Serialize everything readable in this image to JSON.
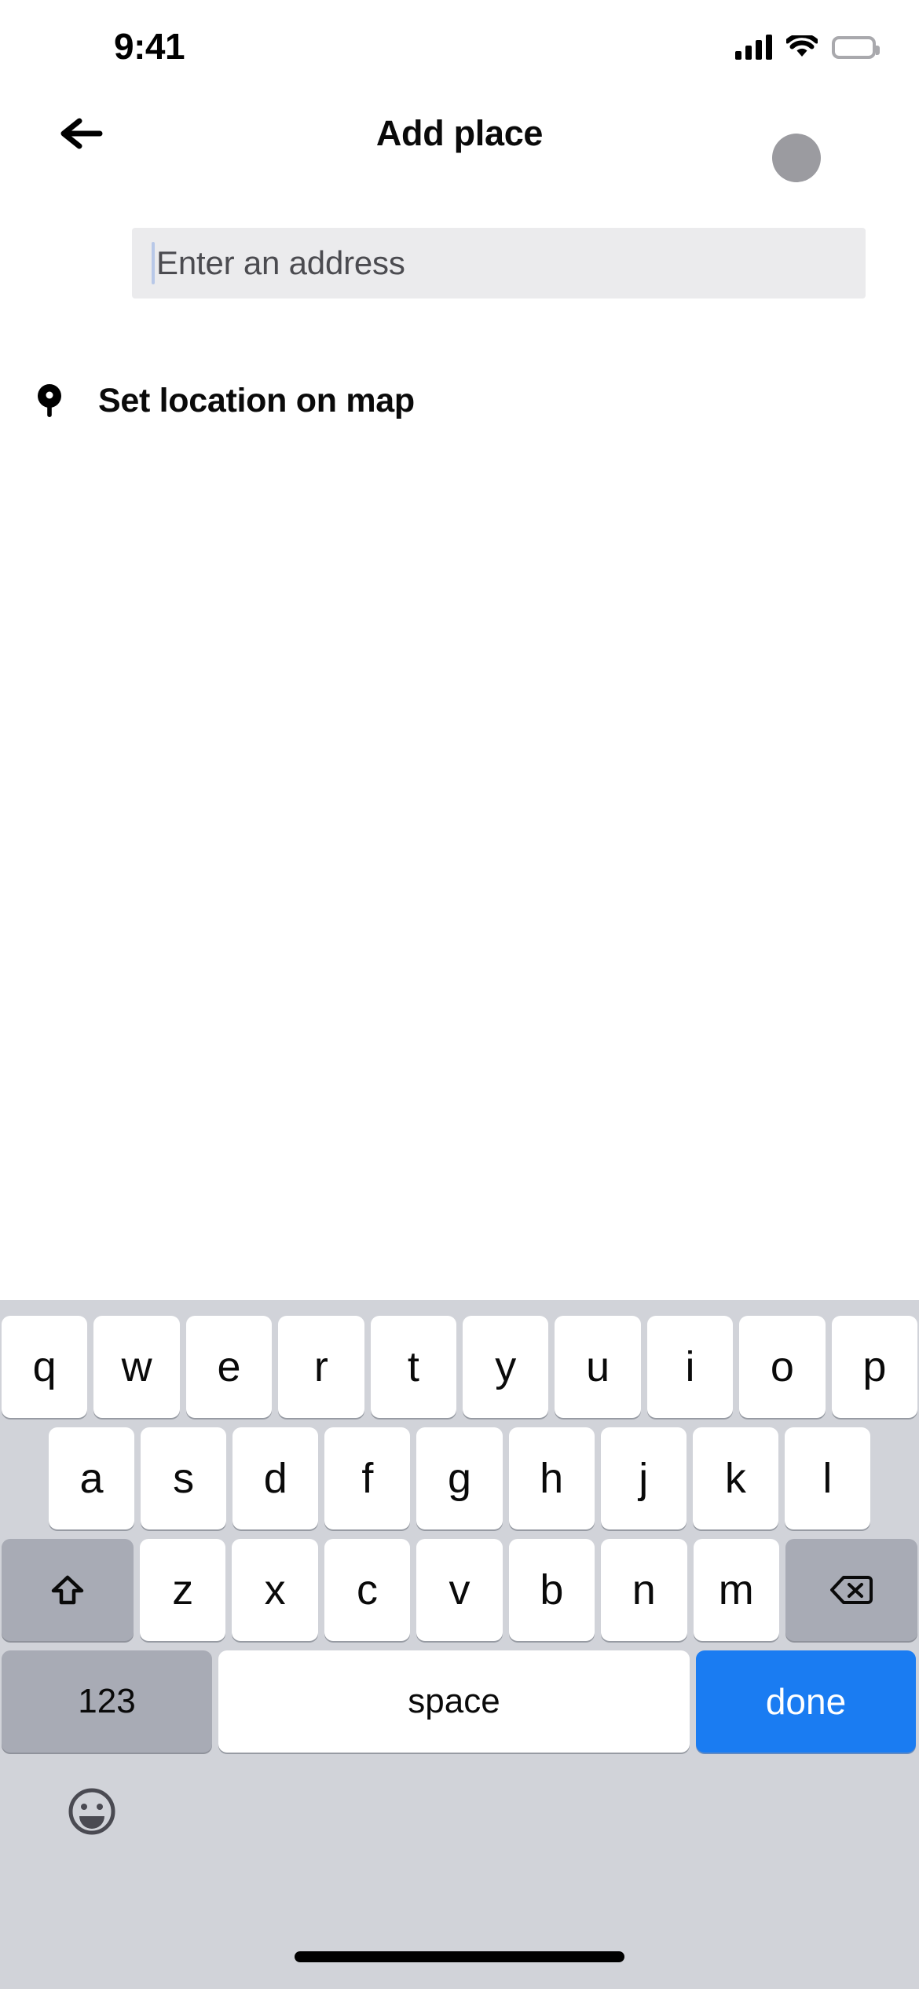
{
  "status_bar": {
    "time": "9:41",
    "signal_icon": "cellular-signal-icon",
    "wifi_icon": "wifi-icon",
    "battery_icon": "battery-full-icon"
  },
  "nav": {
    "back_icon": "back-arrow-icon",
    "title": "Add place",
    "avatar": "user-avatar"
  },
  "search": {
    "placeholder": "Enter an address",
    "value": "",
    "caret_color": "#b8c8e8",
    "background": "#ebebed"
  },
  "options": [
    {
      "icon": "map-pin-icon",
      "label": "Set location on map"
    }
  ],
  "keyboard": {
    "background": "#d1d3d9",
    "key_bg": "#ffffff",
    "modifier_bg": "#a8abb5",
    "accent": "#1a7cf2",
    "rows": [
      {
        "name": "row-1",
        "keys": [
          "q",
          "w",
          "e",
          "r",
          "t",
          "y",
          "u",
          "i",
          "o",
          "p"
        ]
      },
      {
        "name": "row-2",
        "keys": [
          "a",
          "s",
          "d",
          "f",
          "g",
          "h",
          "j",
          "k",
          "l"
        ]
      },
      {
        "name": "row-3",
        "keys": [
          "z",
          "x",
          "c",
          "v",
          "b",
          "n",
          "m"
        ]
      }
    ],
    "shift_icon": "shift-arrow-icon",
    "backspace_icon": "backspace-icon",
    "numeric_label": "123",
    "space_label": "space",
    "done_label": "done",
    "emoji_icon": "emoji-smiley-icon"
  },
  "home_indicator": "home-indicator-bar"
}
